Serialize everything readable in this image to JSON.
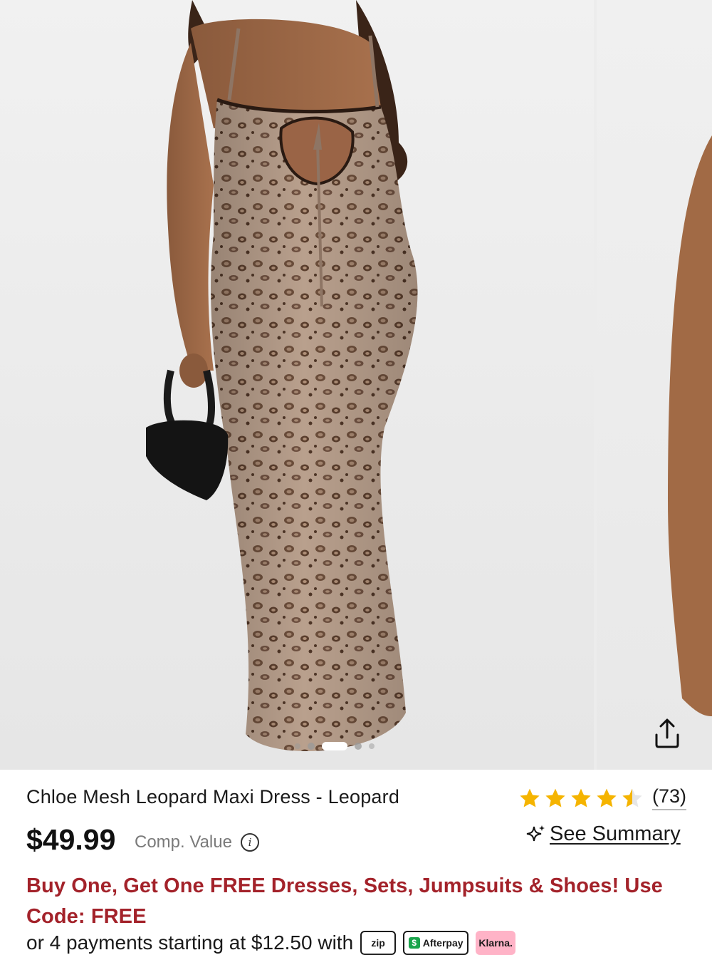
{
  "carousel": {
    "main_image_alt": "Model wearing Chloe Mesh Leopard Maxi Dress",
    "next_image_alt": "Next product image",
    "share_icon": "share-icon",
    "dots_total": 5,
    "active_dot": 3
  },
  "product": {
    "title": "Chloe Mesh Leopard Maxi Dress - Leopard",
    "price": "$49.99",
    "comp_value_label": "Comp. Value",
    "info_icon": "info-icon",
    "rating": {
      "stars": 4.5,
      "count_label": "(73)",
      "star_color": "#f5b400"
    },
    "see_summary": {
      "icon": "sparkle-icon",
      "label": "See Summary"
    },
    "promo_text": "Buy One, Get One FREE Dresses, Sets, Jumpsuits & Shoes! Use Code: FREE",
    "promo_color": "#a3222a",
    "installments": {
      "text": "or 4 payments starting at $12.50 with",
      "providers": [
        "zip",
        "Afterpay",
        "Klarna."
      ]
    }
  }
}
